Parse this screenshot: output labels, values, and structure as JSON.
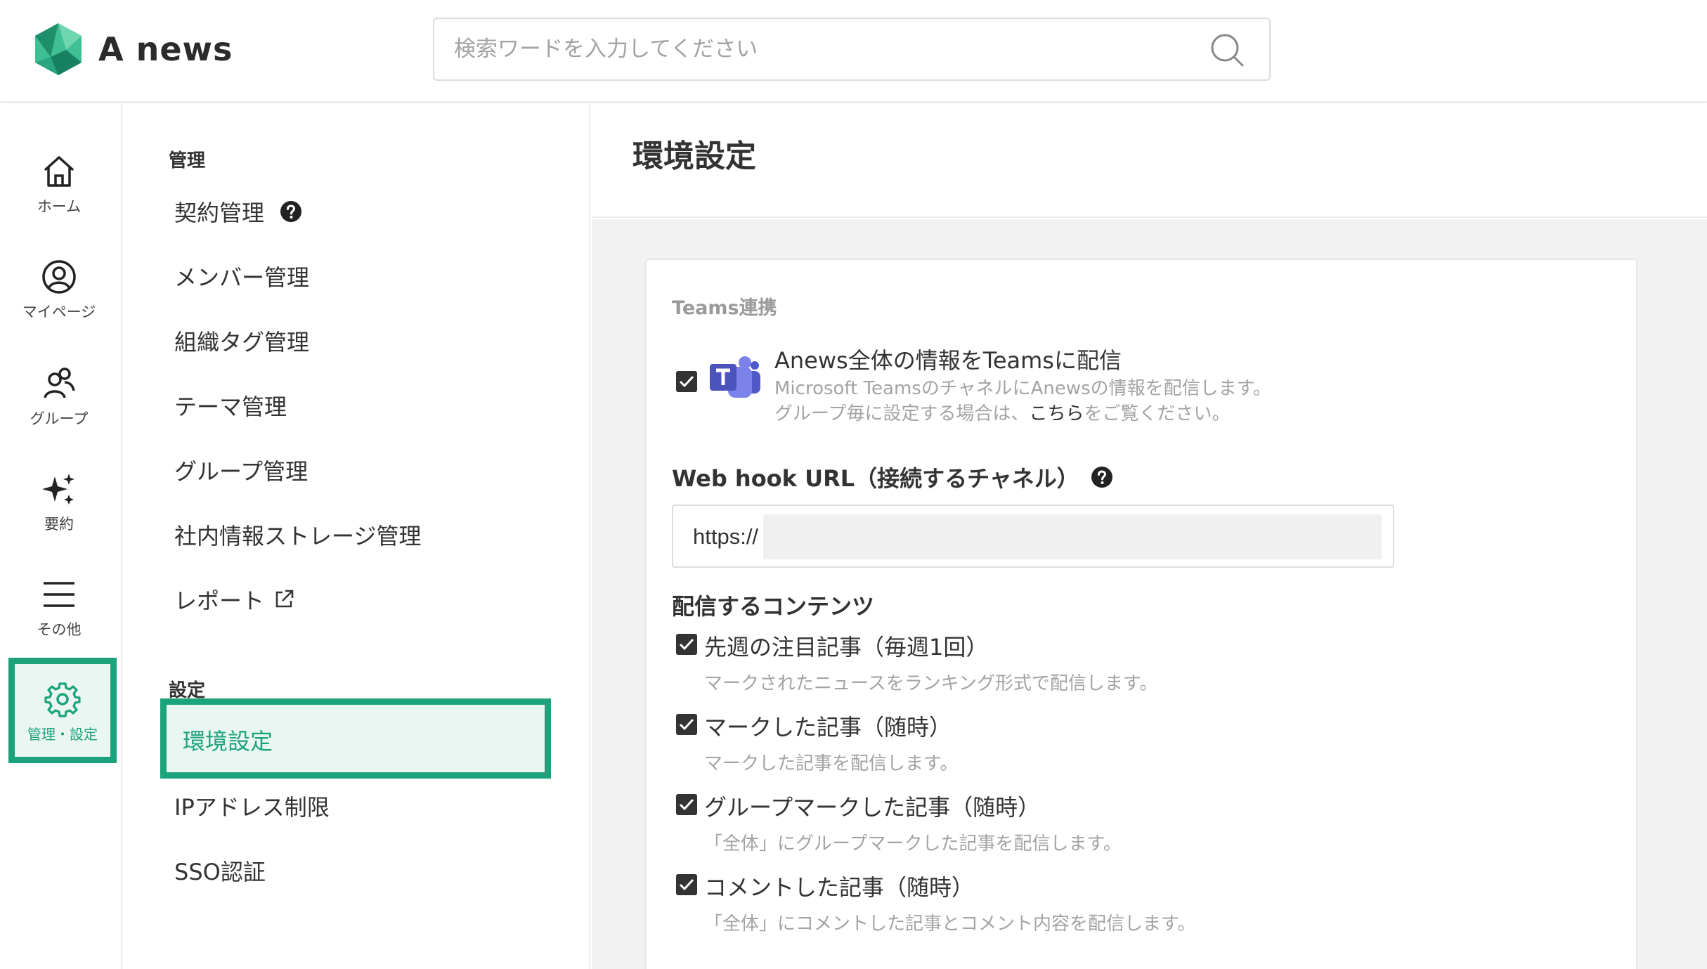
{
  "header": {
    "logo_text": "A news",
    "search_placeholder": "検索ワードを入力してください"
  },
  "rail": {
    "items": [
      {
        "label": "ホーム",
        "icon": "home-icon"
      },
      {
        "label": "マイページ",
        "icon": "user-circle-icon"
      },
      {
        "label": "グループ",
        "icon": "group-icon"
      },
      {
        "label": "要約",
        "icon": "sparkle-icon"
      },
      {
        "label": "その他",
        "icon": "menu-icon"
      },
      {
        "label": "管理・設定",
        "icon": "gear-icon",
        "active": true
      }
    ]
  },
  "menu": {
    "section_admin": "管理",
    "admin_items": [
      "契約管理",
      "メンバー管理",
      "組織タグ管理",
      "テーマ管理",
      "グループ管理",
      "社内情報ストレージ管理",
      "レポート"
    ],
    "section_settings": "設定",
    "settings_items": [
      "環境設定",
      "IPアドレス制限",
      "SSO認証"
    ],
    "active_item": "環境設定"
  },
  "main": {
    "page_title": "環境設定",
    "teams": {
      "section_label": "Teams連携",
      "enabled": true,
      "title": "Anews全体の情報をTeamsに配信",
      "desc_line1": "Microsoft TeamsのチャネルにAnewsの情報を配信します。",
      "desc_line2_pre": "グループ毎に設定する場合は、",
      "desc_line2_link": "こちら",
      "desc_line2_post": "をご覧ください。"
    },
    "webhook": {
      "label": "Web hook URL（接続するチャネル）",
      "value": "https://"
    },
    "contents": {
      "heading": "配信するコンテンツ",
      "options": [
        {
          "title": "先週の注目記事（毎週1回）",
          "desc": "マークされたニュースをランキング形式で配信します。",
          "checked": true
        },
        {
          "title": "マークした記事（随時）",
          "desc": "マークした記事を配信します。",
          "checked": true
        },
        {
          "title": "グループマークした記事（随時）",
          "desc": "「全体」にグループマークした記事を配信します。",
          "checked": true
        },
        {
          "title": "コメントした記事（随時）",
          "desc": "「全体」にコメントした記事とコメント内容を配信します。",
          "checked": true
        }
      ]
    }
  },
  "colors": {
    "accent": "#1ca37c",
    "accent_bg": "#e9f6f1",
    "teams_purple": "#5059c9"
  }
}
